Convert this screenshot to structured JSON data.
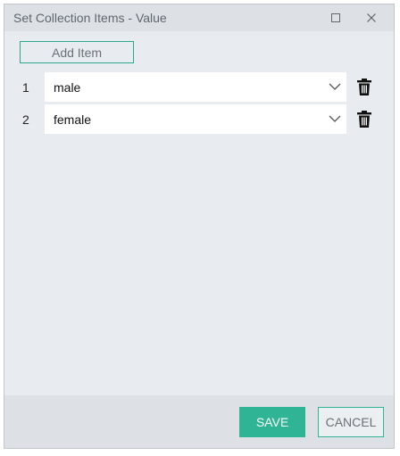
{
  "window": {
    "title": "Set Collection Items - Value",
    "maximize_icon": "maximize-icon",
    "close_icon": "close-icon"
  },
  "toolbar": {
    "add_item_label": "Add Item"
  },
  "items": [
    {
      "index": "1",
      "value": "male"
    },
    {
      "index": "2",
      "value": "female"
    }
  ],
  "footer": {
    "save_label": "SAVE",
    "cancel_label": "CANCEL"
  },
  "colors": {
    "accent": "#2fb596",
    "background": "#e8ebef",
    "titlebar": "#dde1e5"
  }
}
